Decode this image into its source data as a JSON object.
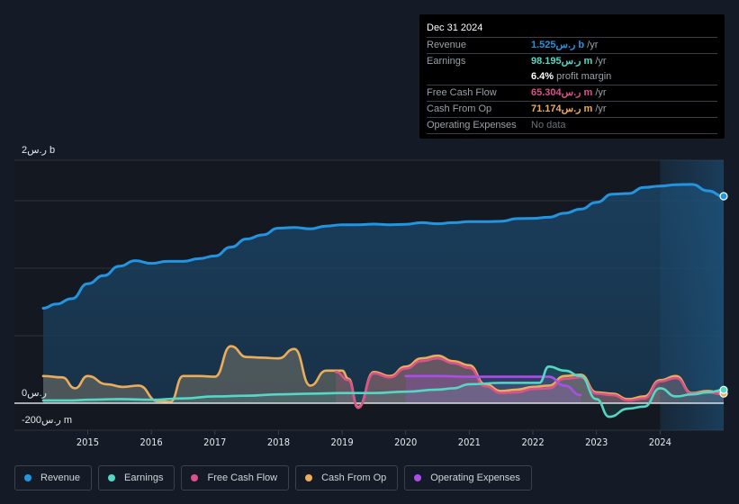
{
  "tooltip": {
    "date": "Dec 31 2024",
    "rows": [
      {
        "label": "Revenue",
        "value": "1.525ر.س b",
        "unit": " /yr",
        "color": "#2394e0"
      },
      {
        "label": "Earnings",
        "value": "98.195ر.س m",
        "unit": " /yr",
        "color": "#56d7c5"
      },
      {
        "label": "",
        "value": "6.4%",
        "unit": " profit margin",
        "color": "#ffffff"
      },
      {
        "label": "Free Cash Flow",
        "value": "65.304ر.س m",
        "unit": " /yr",
        "color": "#d9528a"
      },
      {
        "label": "Cash From Op",
        "value": "71.174ر.س m",
        "unit": " /yr",
        "color": "#eaad5b"
      },
      {
        "label": "Operating Expenses",
        "value": "No data",
        "unit": "",
        "color": "#6b7079"
      }
    ]
  },
  "axis": {
    "y_top_label": "2ر.س b",
    "y_zero_label": "0ر.س",
    "y_neg_label": "-200ر.س m"
  },
  "legend": [
    {
      "label": "Revenue",
      "color": "#2394e0"
    },
    {
      "label": "Earnings",
      "color": "#56d7c5"
    },
    {
      "label": "Free Cash Flow",
      "color": "#d9528a"
    },
    {
      "label": "Cash From Op",
      "color": "#eaad5b"
    },
    {
      "label": "Operating Expenses",
      "color": "#a94fe6"
    }
  ],
  "chart_data": {
    "type": "line",
    "title": "",
    "xlabel": "",
    "ylabel": "",
    "units": "SAR (ر.س)",
    "x_ticks": [
      "2015",
      "2016",
      "2017",
      "2018",
      "2019",
      "2020",
      "2021",
      "2022",
      "2023",
      "2024"
    ],
    "x_range": [
      2014.3,
      2025.0
    ],
    "ylim": [
      -200,
      2000
    ],
    "highlight_from": 2024.0,
    "series": [
      {
        "name": "Revenue",
        "color": "#2394e0",
        "fill": true,
        "x": [
          2014.3,
          2014.5,
          2014.75,
          2015.0,
          2015.25,
          2015.5,
          2015.75,
          2016.0,
          2016.25,
          2016.5,
          2016.75,
          2017.0,
          2017.25,
          2017.5,
          2017.75,
          2018.0,
          2018.25,
          2018.5,
          2018.75,
          2019.0,
          2019.25,
          2019.5,
          2019.75,
          2020.0,
          2020.25,
          2020.5,
          2020.75,
          2021.0,
          2021.25,
          2021.5,
          2021.75,
          2022.0,
          2022.25,
          2022.5,
          2022.75,
          2023.0,
          2023.25,
          2023.5,
          2023.75,
          2024.0,
          2024.25,
          2024.5,
          2024.75,
          2025.0
        ],
        "values": [
          700,
          730,
          770,
          880,
          940,
          1010,
          1050,
          1030,
          1045,
          1045,
          1065,
          1085,
          1150,
          1210,
          1240,
          1290,
          1295,
          1285,
          1305,
          1315,
          1315,
          1320,
          1315,
          1318,
          1330,
          1322,
          1330,
          1338,
          1338,
          1340,
          1360,
          1362,
          1370,
          1400,
          1430,
          1480,
          1540,
          1545,
          1590,
          1600,
          1610,
          1612,
          1565,
          1525
        ]
      },
      {
        "name": "Earnings",
        "color": "#56d7c5",
        "fill": true,
        "x": [
          2014.3,
          2014.75,
          2015.0,
          2015.5,
          2016.0,
          2016.5,
          2017.0,
          2017.5,
          2018.0,
          2018.5,
          2019.0,
          2019.5,
          2020.0,
          2020.5,
          2020.75,
          2021.0,
          2021.5,
          2021.9,
          2022.1,
          2022.25,
          2022.5,
          2022.75,
          2023.0,
          2023.2,
          2023.5,
          2023.75,
          2024.0,
          2024.25,
          2024.5,
          2024.75,
          2025.0
        ],
        "values": [
          20,
          20,
          25,
          30,
          25,
          35,
          50,
          55,
          65,
          70,
          75,
          75,
          85,
          100,
          110,
          140,
          150,
          150,
          150,
          270,
          240,
          200,
          30,
          -100,
          -40,
          -25,
          110,
          50,
          65,
          80,
          98
        ]
      },
      {
        "name": "Cash From Op",
        "color": "#eaad5b",
        "fill": true,
        "x": [
          2014.3,
          2014.6,
          2014.8,
          2015.0,
          2015.3,
          2015.55,
          2015.8,
          2016.1,
          2016.3,
          2016.5,
          2016.75,
          2017.0,
          2017.25,
          2017.5,
          2017.75,
          2018.0,
          2018.25,
          2018.5,
          2018.75,
          2019.0,
          2019.1,
          2019.25,
          2019.5,
          2019.75,
          2020.0,
          2020.25,
          2020.5,
          2020.75,
          2021.0,
          2021.25,
          2021.5,
          2021.75,
          2022.0,
          2022.25,
          2022.5,
          2022.75,
          2023.0,
          2023.25,
          2023.5,
          2023.75,
          2024.0,
          2024.25,
          2024.5,
          2024.75,
          2025.0
        ],
        "values": [
          200,
          190,
          110,
          200,
          140,
          120,
          130,
          15,
          10,
          200,
          200,
          195,
          420,
          340,
          335,
          330,
          400,
          130,
          240,
          240,
          180,
          -30,
          230,
          200,
          270,
          330,
          350,
          310,
          280,
          140,
          90,
          100,
          120,
          130,
          200,
          210,
          80,
          70,
          30,
          50,
          170,
          200,
          75,
          90,
          71
        ]
      },
      {
        "name": "Free Cash Flow",
        "color": "#d9528a",
        "fill": true,
        "x": [
          2018.9,
          2019.1,
          2019.25,
          2019.5,
          2019.75,
          2020.0,
          2020.25,
          2020.5,
          2020.75,
          2021.0,
          2021.25,
          2021.5,
          2021.75,
          2022.0,
          2022.25,
          2022.5,
          2022.75,
          2023.0,
          2023.25,
          2023.5,
          2023.75,
          2024.0,
          2024.25,
          2024.5,
          2024.75,
          2025.0
        ],
        "values": [
          230,
          170,
          -35,
          220,
          190,
          255,
          310,
          330,
          295,
          260,
          125,
          75,
          80,
          105,
          110,
          180,
          190,
          70,
          60,
          20,
          35,
          160,
          185,
          70,
          80,
          65
        ]
      },
      {
        "name": "Operating Expenses",
        "color": "#a94fe6",
        "fill": true,
        "x": [
          2020.0,
          2020.5,
          2021.0,
          2021.5,
          2022.0,
          2022.25,
          2022.5,
          2022.75
        ],
        "values": [
          200,
          200,
          195,
          195,
          195,
          195,
          130,
          60
        ]
      }
    ]
  }
}
